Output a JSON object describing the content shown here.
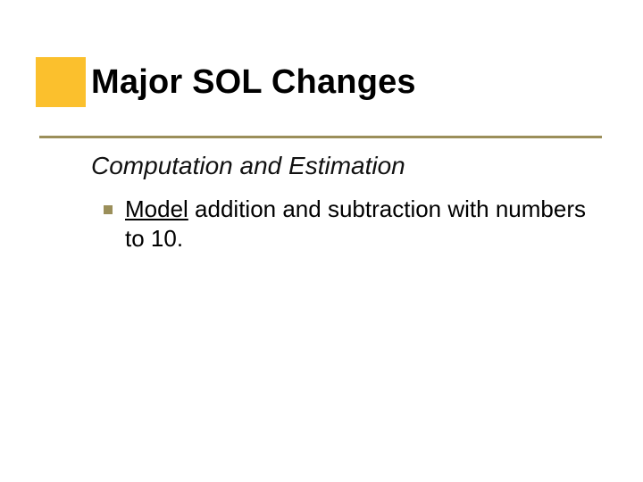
{
  "slide": {
    "title": "Major SOL Changes",
    "subtitle": "Computation and Estimation",
    "bullet": {
      "underlined_word": "Model",
      "rest": " addition and subtraction with numbers to 10."
    }
  },
  "colors": {
    "accent_square": "#fbc02d",
    "rule": "#9b8f5a",
    "bullet_marker": "#9b8f5a"
  }
}
